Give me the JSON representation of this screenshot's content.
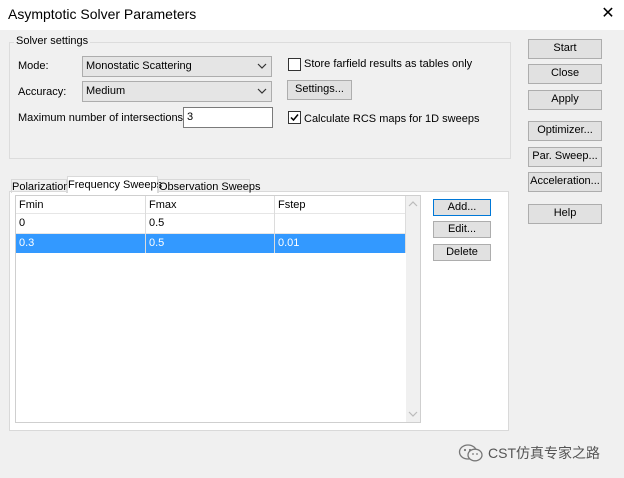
{
  "window": {
    "title": "Asymptotic Solver Parameters"
  },
  "solver_settings": {
    "group_label": "Solver settings",
    "mode_label": "Mode:",
    "mode_value": "Monostatic Scattering",
    "accuracy_label": "Accuracy:",
    "accuracy_value": "Medium",
    "max_intersections_label": "Maximum number of intersections:",
    "max_intersections_value": "3",
    "store_farfield_label": "Store farfield results as tables only",
    "store_farfield_checked": false,
    "settings_button": "Settings...",
    "calc_rcs_label": "Calculate RCS maps for 1D sweeps",
    "calc_rcs_checked": true
  },
  "tabs": [
    {
      "label": "Polarization",
      "active": false
    },
    {
      "label": "Frequency Sweeps",
      "active": true
    },
    {
      "label": "Observation Sweeps",
      "active": false
    }
  ],
  "table": {
    "columns": [
      "Fmin",
      "Fmax",
      "Fstep"
    ],
    "rows": [
      {
        "fmin": "0",
        "fmax": "0.5",
        "fstep": "",
        "selected": false
      },
      {
        "fmin": "0.3",
        "fmax": "0.5",
        "fstep": "0.01",
        "selected": true
      }
    ]
  },
  "table_buttons": {
    "add": "Add...",
    "edit": "Edit...",
    "delete": "Delete"
  },
  "right_buttons": {
    "start": "Start",
    "close": "Close",
    "apply": "Apply",
    "optimizer": "Optimizer...",
    "par_sweep": "Par. Sweep...",
    "acceleration": "Acceleration...",
    "help": "Help"
  },
  "watermark": {
    "text": "CST仿真专家之路"
  },
  "colors": {
    "selection": "#3399ff",
    "window_bg": "#f0f0f0"
  }
}
